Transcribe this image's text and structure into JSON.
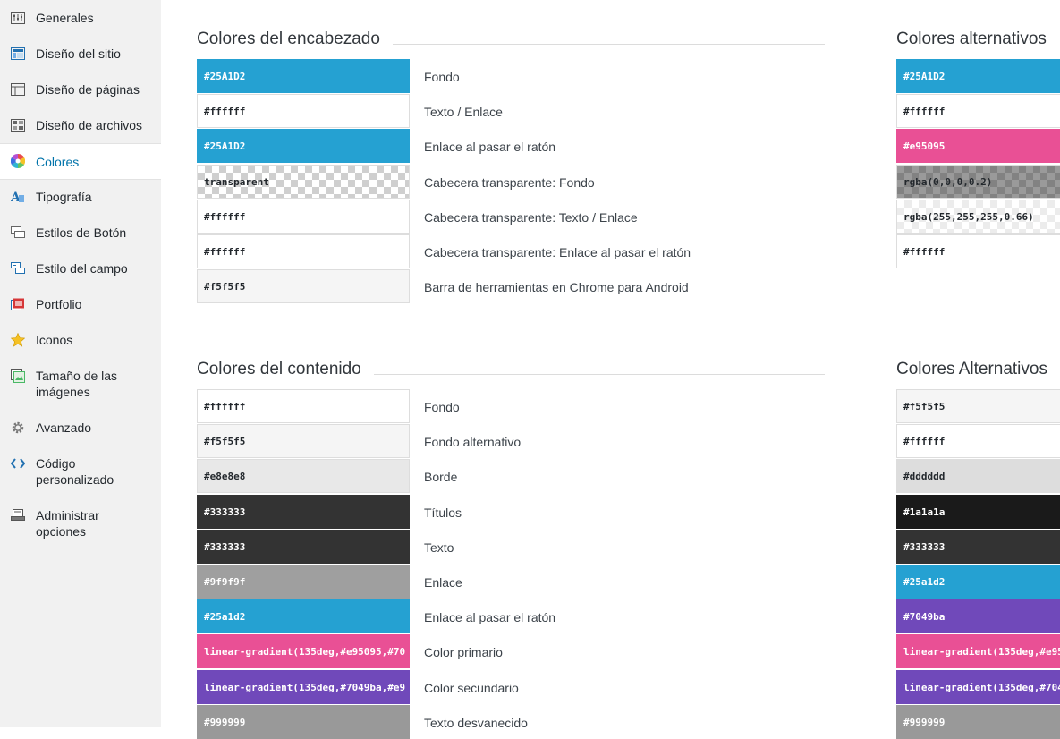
{
  "sidebar": {
    "items": [
      {
        "label": "Generales",
        "icon": "sliders-icon"
      },
      {
        "label": "Diseño del sitio",
        "icon": "site-layout-icon"
      },
      {
        "label": "Diseño de páginas",
        "icon": "page-layout-icon"
      },
      {
        "label": "Diseño de archivos",
        "icon": "archive-layout-icon"
      },
      {
        "label": "Colores",
        "icon": "color-wheel-icon",
        "active": true
      },
      {
        "label": "Tipografía",
        "icon": "typography-icon"
      },
      {
        "label": "Estilos de Botón",
        "icon": "button-icon"
      },
      {
        "label": "Estilo del campo",
        "icon": "field-icon"
      },
      {
        "label": "Portfolio",
        "icon": "portfolio-icon"
      },
      {
        "label": "Iconos",
        "icon": "star-icon"
      },
      {
        "label": "Tamaño de las imágenes",
        "icon": "images-icon"
      },
      {
        "label": "Avanzado",
        "icon": "gear-icon"
      },
      {
        "label": "Código personalizado",
        "icon": "code-icon"
      },
      {
        "label": "Administrar opciones",
        "icon": "admin-icon"
      }
    ]
  },
  "header_colors": {
    "title": "Colores del encabezado",
    "rows": [
      {
        "value": "#25A1D2",
        "label": "Fondo",
        "bg": "#25A1D2",
        "style": "dark"
      },
      {
        "value": "#ffffff",
        "label": "Texto / Enlace",
        "bg": "#ffffff",
        "style": "light"
      },
      {
        "value": "#25A1D2",
        "label": "Enlace al pasar el ratón",
        "bg": "#25A1D2",
        "style": "dark"
      },
      {
        "value": "transparent",
        "label": "Cabecera transparente: Fondo",
        "bg": "checker",
        "style": "light"
      },
      {
        "value": "#ffffff",
        "label": "Cabecera transparente: Texto / Enlace",
        "bg": "#ffffff",
        "style": "light"
      },
      {
        "value": "#ffffff",
        "label": "Cabecera transparente: Enlace al pasar el ratón",
        "bg": "#ffffff",
        "style": "light"
      },
      {
        "value": "#f5f5f5",
        "label": "Barra de herramientas en Chrome para Android",
        "bg": "#f5f5f5",
        "style": "light"
      }
    ]
  },
  "alt_header_colors": {
    "title": "Colores alternativos",
    "rows": [
      {
        "value": "#25A1D2",
        "bg": "#25A1D2",
        "style": "dark"
      },
      {
        "value": "#ffffff",
        "bg": "#ffffff",
        "style": "light"
      },
      {
        "value": "#e95095",
        "bg": "#e95095",
        "style": "dark"
      },
      {
        "value": "rgba(0,0,0,0.2)",
        "bg": "checker-dim",
        "style": "light"
      },
      {
        "value": "rgba(255,255,255,0.66)",
        "bg": "checker-light",
        "style": "light"
      },
      {
        "value": "#ffffff",
        "bg": "#ffffff",
        "style": "light"
      }
    ]
  },
  "content_colors": {
    "title": "Colores del contenido",
    "rows": [
      {
        "value": "#ffffff",
        "label": "Fondo",
        "bg": "#ffffff",
        "style": "light"
      },
      {
        "value": "#f5f5f5",
        "label": "Fondo alternativo",
        "bg": "#f5f5f5",
        "style": "light"
      },
      {
        "value": "#e8e8e8",
        "label": "Borde",
        "bg": "#e8e8e8",
        "style": "light"
      },
      {
        "value": "#333333",
        "label": "Títulos",
        "bg": "#333333",
        "style": "dark"
      },
      {
        "value": "#333333",
        "label": "Texto",
        "bg": "#333333",
        "style": "dark"
      },
      {
        "value": "#9f9f9f",
        "label": "Enlace",
        "bg": "#9f9f9f",
        "style": "dark"
      },
      {
        "value": "#25a1d2",
        "label": "Enlace al pasar el ratón",
        "bg": "#25a1d2",
        "style": "dark"
      },
      {
        "value": "linear-gradient(135deg,#e95095,#70",
        "label": "Color primario",
        "bg": "#e95095",
        "style": "dark"
      },
      {
        "value": "linear-gradient(135deg,#7049ba,#e9",
        "label": "Color secundario",
        "bg": "#7049ba",
        "style": "dark"
      },
      {
        "value": "#999999",
        "label": "Texto desvanecido",
        "bg": "#999999",
        "style": "dark"
      }
    ]
  },
  "alt_content_colors": {
    "title": "Colores Alternativos",
    "rows": [
      {
        "value": "#f5f5f5",
        "bg": "#f5f5f5",
        "style": "light"
      },
      {
        "value": "#ffffff",
        "bg": "#ffffff",
        "style": "light"
      },
      {
        "value": "#dddddd",
        "bg": "#dddddd",
        "style": "light"
      },
      {
        "value": "#1a1a1a",
        "bg": "#1a1a1a",
        "style": "dark"
      },
      {
        "value": "#333333",
        "bg": "#333333",
        "style": "dark"
      },
      {
        "value": "#25a1d2",
        "bg": "#25a1d2",
        "style": "dark"
      },
      {
        "value": "#7049ba",
        "bg": "#7049ba",
        "style": "dark"
      },
      {
        "value": "linear-gradient(135deg,#e95",
        "bg": "#e95095",
        "style": "dark"
      },
      {
        "value": "linear-gradient(135deg,#704",
        "bg": "#7049ba",
        "style": "dark"
      },
      {
        "value": "#999999",
        "bg": "#999999",
        "style": "dark"
      }
    ]
  }
}
